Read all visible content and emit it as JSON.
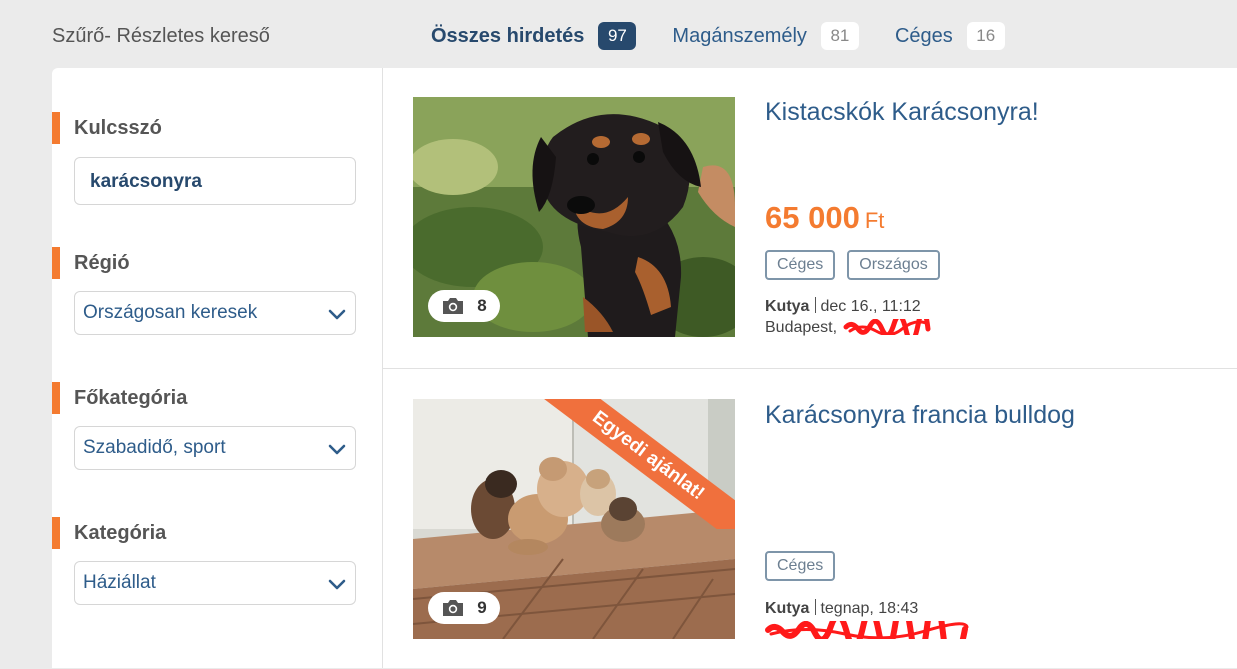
{
  "header": {
    "filter_title": "Szűrő- Részletes kereső",
    "tabs": [
      {
        "label": "Összes hirdetés",
        "count": "97",
        "active": true
      },
      {
        "label": "Magánszemély",
        "count": "81",
        "active": false
      },
      {
        "label": "Céges",
        "count": "16",
        "active": false
      }
    ]
  },
  "sidebar": {
    "keyword": {
      "label": "Kulcsszó",
      "value": "karácsonyra"
    },
    "region": {
      "label": "Régió",
      "value": "Országosan keresek"
    },
    "main_category": {
      "label": "Főkategória",
      "value": "Szabadidő, sport"
    },
    "category": {
      "label": "Kategória",
      "value": "Háziállat"
    }
  },
  "listings": [
    {
      "title": "Kistacskók Karácsonyra!",
      "price": "65 000",
      "currency": "Ft",
      "tags": [
        "Céges",
        "Országos"
      ],
      "category": "Kutya",
      "date": "dec 16., 11:12",
      "location": "Budapest,",
      "photo_count": "8"
    },
    {
      "title": "Karácsonyra francia bulldog",
      "ribbon": "Egyedi ajánlat!",
      "tags": [
        "Céges"
      ],
      "category": "Kutya",
      "date": "tegnap, 18:43",
      "photo_count": "9"
    }
  ],
  "colors": {
    "accent": "#f47b30",
    "link": "#2e5c8a",
    "active_badge": "#27496d",
    "redaction": "#ff0000"
  }
}
